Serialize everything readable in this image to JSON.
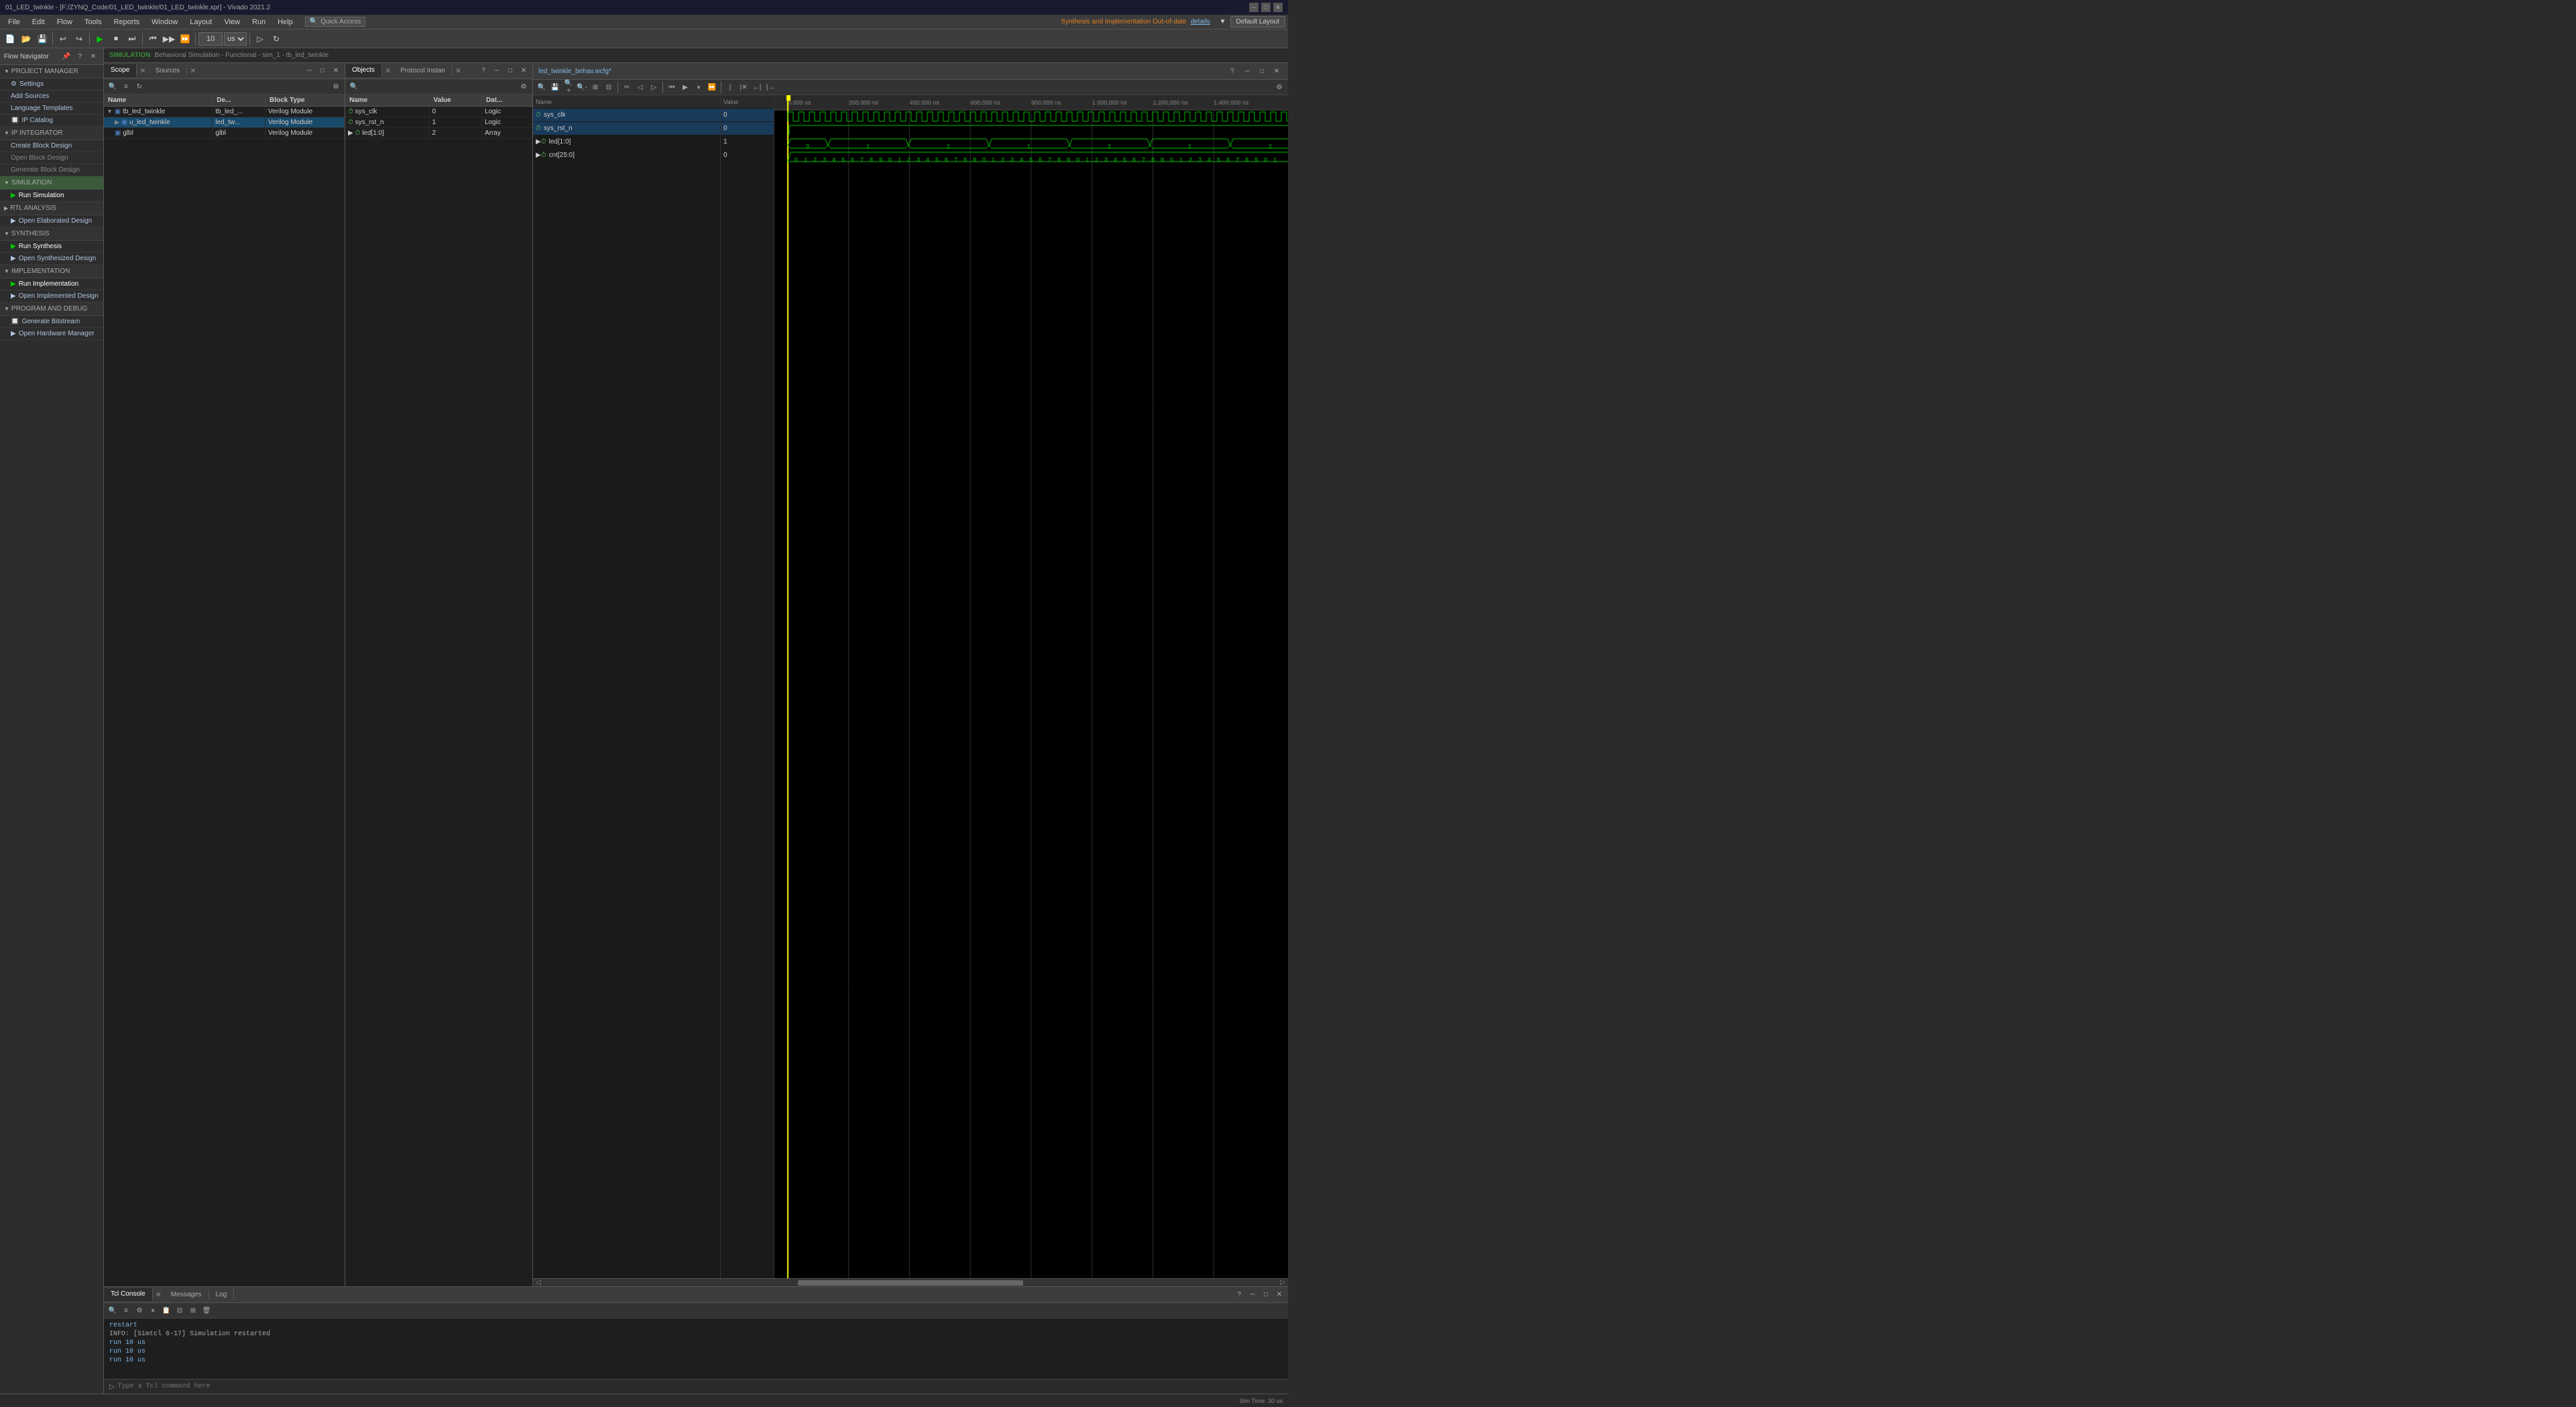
{
  "titleBar": {
    "title": "01_LED_twinkle - [F:/ZYNQ_Code/01_LED_twinkle/01_LED_twinkle.xpr] - Vivado 2021.2",
    "controls": [
      "minimize",
      "maximize",
      "close"
    ]
  },
  "menuBar": {
    "items": [
      "File",
      "Edit",
      "Flow",
      "Tools",
      "Reports",
      "Window",
      "Layout",
      "View",
      "Run",
      "Help"
    ],
    "quickAccess": "Quick Access"
  },
  "toolbar": {
    "runInput": "10",
    "runUnit": "us",
    "synthesisStatus": "Synthesis and Implementation Out-of-date",
    "detailsLabel": "details"
  },
  "flowNavigator": {
    "header": "Flow Navigator",
    "sections": [
      {
        "name": "PROJECT MANAGER",
        "items": [
          "Settings",
          "Add Sources",
          "Language Templates",
          "IP Catalog"
        ]
      },
      {
        "name": "IP INTEGRATOR",
        "items": [
          "Create Block Design",
          "Open Block Design",
          "Generate Block Design"
        ]
      },
      {
        "name": "SIMULATION",
        "items": [
          "Run Simulation"
        ]
      },
      {
        "name": "RTL ANALYSIS",
        "items": [
          "Open Elaborated Design"
        ]
      },
      {
        "name": "SYNTHESIS",
        "items": [
          "Run Synthesis",
          "Open Synthesized Design"
        ]
      },
      {
        "name": "IMPLEMENTATION",
        "items": [
          "Run Implementation",
          "Open Implemented Design"
        ]
      },
      {
        "name": "PROGRAM AND DEBUG",
        "items": [
          "Generate Bitstream",
          "Open Hardware Manager"
        ]
      }
    ]
  },
  "simTab": {
    "label": "SIMULATION",
    "subtitle": "Behavioral Simulation - Functional - sim_1 - tb_led_twinkle"
  },
  "scopePanel": {
    "tab": "Scope",
    "columns": [
      "Name",
      "Description",
      "Block Type"
    ],
    "rows": [
      {
        "name": "tb_led_twinkle",
        "desc": "tb_led_...",
        "type": "Verilog Module",
        "expanded": true,
        "indent": 0
      },
      {
        "name": "u_led_twinkle",
        "desc": "led_tw...",
        "type": "Verilog Module",
        "expanded": false,
        "indent": 1,
        "selected": true
      },
      {
        "name": "glbl",
        "desc": "glbl",
        "type": "Verilog Module",
        "expanded": false,
        "indent": 1
      }
    ]
  },
  "sourcesPanel": {
    "tab": "Sources"
  },
  "objectsPanel": {
    "tabs": [
      "Objects",
      "Protocol Instan"
    ],
    "columns": [
      "Name",
      "Value",
      "Data Type"
    ],
    "rows": [
      {
        "name": "sys_clk",
        "value": "0",
        "type": "Logic"
      },
      {
        "name": "sys_rst_n",
        "value": "1",
        "type": "Logic"
      },
      {
        "name": "led[1:0]",
        "value": "2",
        "type": "Array"
      }
    ]
  },
  "waveform": {
    "title": "led_twinkle_behav.wcfg*",
    "signals": [
      {
        "name": "sys_clk",
        "value": "0",
        "selected": true,
        "type": "clk"
      },
      {
        "name": "sys_rst_n",
        "value": "0",
        "selected": true,
        "type": "bit"
      },
      {
        "name": "led[1:0]",
        "value": "1",
        "selected": false,
        "type": "bus"
      },
      {
        "name": "cnt[25:0]",
        "value": "0",
        "selected": false,
        "type": "bus"
      }
    ],
    "timeMarkers": [
      "0.000 ns",
      "200.000 ns",
      "400.000 ns",
      "600.000 ns",
      "800.000 ns",
      "1.000.000 ns",
      "1.200.000 ns",
      "1.400.000 ns"
    ],
    "cursorTime": "0.000 ns"
  },
  "tclConsole": {
    "tabs": [
      "Tcl Console",
      "Messages",
      "Log"
    ],
    "activeTab": "Tcl Console",
    "lines": [
      {
        "text": "restart",
        "type": "cmd"
      },
      {
        "text": "INFO: [Simtcl 6-17] Simulation restarted",
        "type": "info"
      },
      {
        "text": "run 10 us",
        "type": "cmd"
      },
      {
        "text": "run 10 us",
        "type": "cmd"
      },
      {
        "text": "run 10 us",
        "type": "cmd"
      }
    ],
    "inputPlaceholder": "Type a Tcl command here"
  },
  "statusBar": {
    "simTime": "Sim Time: 30 us"
  },
  "defaultLayout": {
    "label": "Default Layout"
  }
}
